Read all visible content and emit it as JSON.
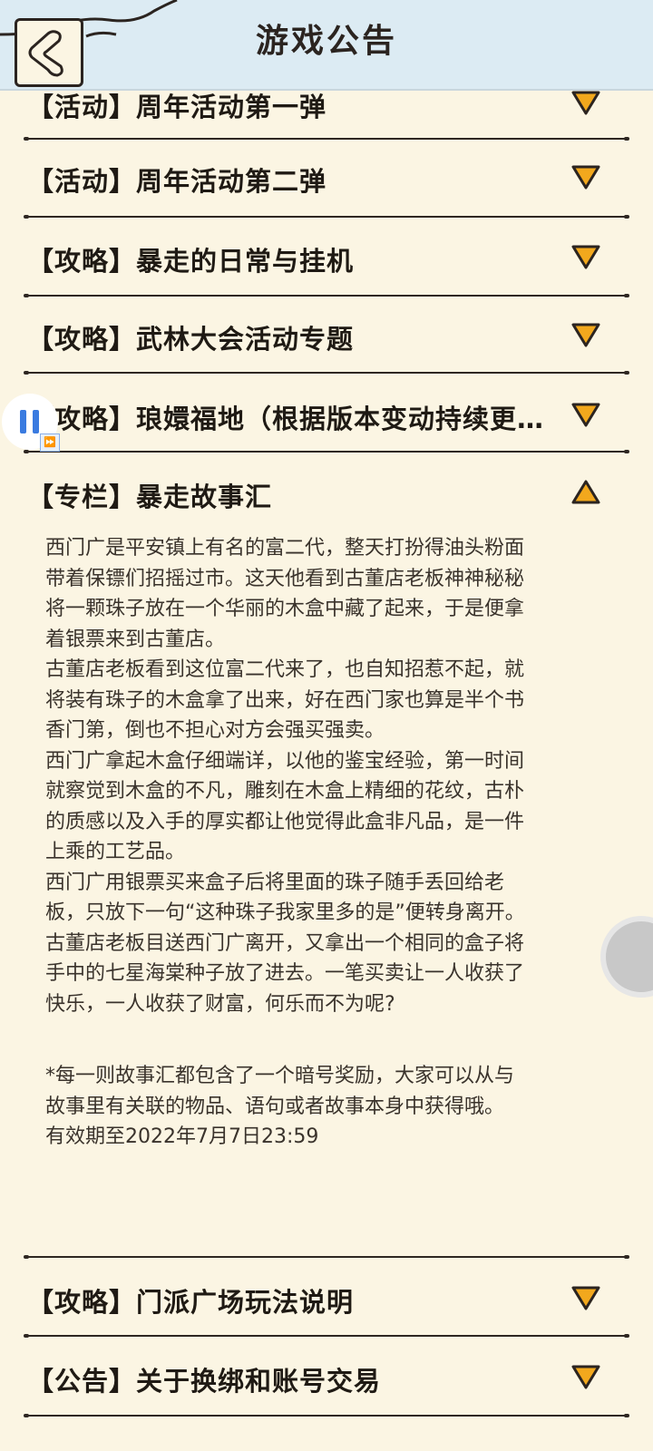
{
  "header": {
    "title": "游戏公告"
  },
  "items": [
    {
      "label": "【活动】周年活动第一弹",
      "expanded": false
    },
    {
      "label": "【活动】周年活动第二弹",
      "expanded": false
    },
    {
      "label": "【攻略】暴走的日常与挂机",
      "expanded": false
    },
    {
      "label": "【攻略】武林大会活动专题",
      "expanded": false
    },
    {
      "label": "【攻略】琅嬛福地（根据版本变动持续更…",
      "expanded": false
    },
    {
      "label": "【专栏】暴走故事汇",
      "expanded": true
    },
    {
      "label": "【攻略】门派广场玩法说明",
      "expanded": false
    },
    {
      "label": "【公告】关于换绑和账号交易",
      "expanded": false
    }
  ],
  "story": {
    "lines": [
      "西门广是平安镇上有名的富二代，整天打扮得油头粉面",
      "带着保镖们招摇过市。这天他看到古董店老板神神秘秘",
      "将一颗珠子放在一个华丽的木盒中藏了起来，于是便拿",
      "着银票来到古董店。",
      "古董店老板看到这位富二代来了，也自知招惹不起，就",
      "将装有珠子的木盒拿了出来，好在西门家也算是半个书",
      "香门第，倒也不担心对方会强买强卖。",
      "西门广拿起木盒仔细端详，以他的鉴宝经验，第一时间",
      "就察觉到木盒的不凡，雕刻在木盒上精细的花纹，古朴",
      "的质感以及入手的厚实都让他觉得此盒非凡品，是一件",
      "上乘的工艺品。",
      "西门广用银票买来盒子后将里面的珠子随手丢回给老",
      "板，只放下一句“这种珠子我家里多的是”便转身离开。",
      "古董店老板目送西门广离开，又拿出一个相同的盒子将",
      "手中的七星海棠种子放了进去。一笔买卖让一人收获了",
      "快乐，一人收获了财富，何乐而不为呢?"
    ],
    "note_lines": [
      "*每一则故事汇都包含了一个暗号奖励，大家可以从与",
      "故事里有关联的物品、语句或者故事本身中获得哦。",
      "有效期至2022年7月7日23:59"
    ]
  },
  "colors": {
    "header_bg": "#dcebf3",
    "page_bg": "#fbf5e3",
    "chevron": "#f2a81d"
  }
}
